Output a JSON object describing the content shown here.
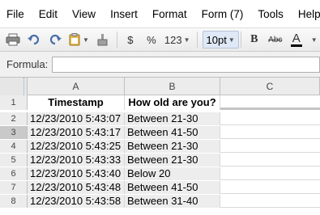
{
  "menu": [
    "File",
    "Edit",
    "View",
    "Insert",
    "Format",
    "Form (7)",
    "Tools",
    "Help"
  ],
  "toolbar": {
    "currency": "$",
    "percent": "%",
    "number_format": "123",
    "font_size": "10pt",
    "bold": "B",
    "strike": "Abc",
    "text_color": "A"
  },
  "formula": {
    "label": "Formula:",
    "value": ""
  },
  "columns": [
    "A",
    "B",
    "C"
  ],
  "rows": [
    {
      "num": "1",
      "a": "Timestamp",
      "b": "How old are you?"
    },
    {
      "num": "2",
      "a": "12/23/2010 5:43:07",
      "b": "Between 21-30"
    },
    {
      "num": "3",
      "a": "12/23/2010 5:43:17",
      "b": "Between 41-50"
    },
    {
      "num": "4",
      "a": "12/23/2010 5:43:25",
      "b": "Between 21-30"
    },
    {
      "num": "5",
      "a": "12/23/2010 5:43:33",
      "b": "Between 21-30"
    },
    {
      "num": "6",
      "a": "12/23/2010 5:43:40",
      "b": "Below 20"
    },
    {
      "num": "7",
      "a": "12/23/2010 5:43:48",
      "b": "Between 41-50"
    },
    {
      "num": "8",
      "a": "12/23/2010 5:43:58",
      "b": "Between 31-40"
    }
  ]
}
